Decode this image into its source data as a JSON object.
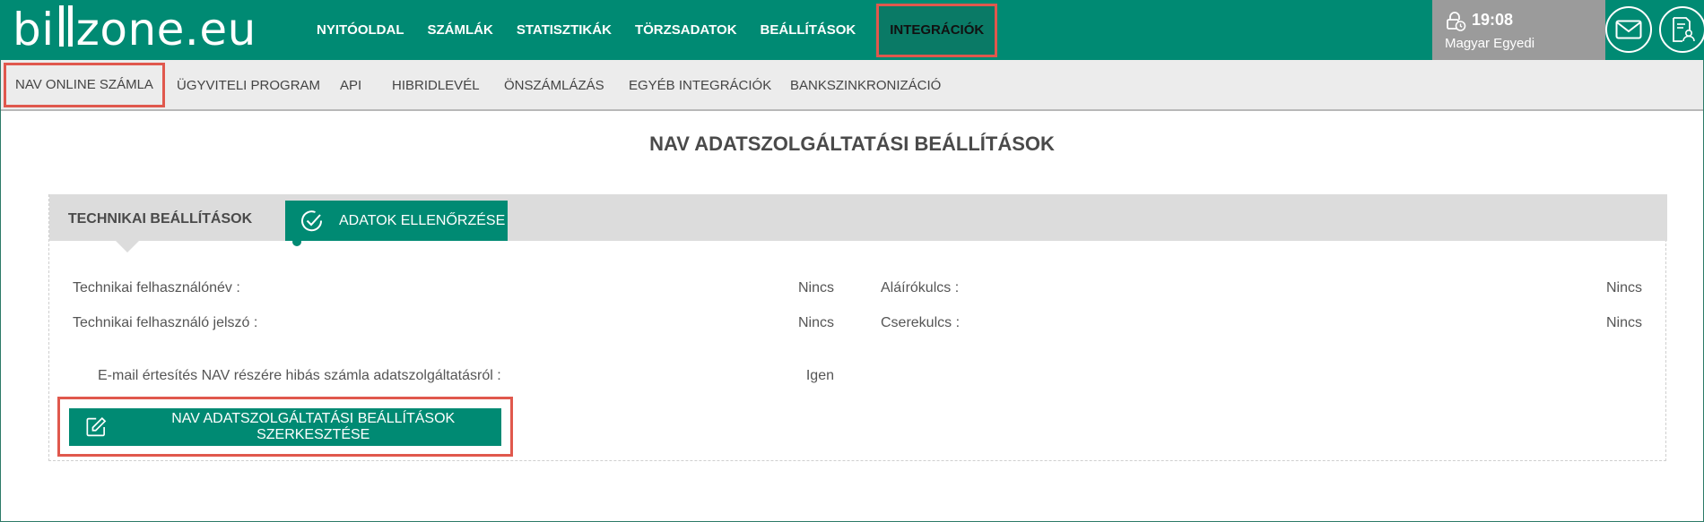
{
  "brand": {
    "logo_text_pre": "bi",
    "logo_text_post": "zone.eu"
  },
  "main_nav": [
    {
      "label": "NYITÓOLDAL"
    },
    {
      "label": "SZÁMLÁK"
    },
    {
      "label": "STATISZTIKÁK"
    },
    {
      "label": "TÖRZSADATOK"
    },
    {
      "label": "BEÁLLÍTÁSOK"
    },
    {
      "label": "INTEGRÁCIÓK",
      "active": true
    }
  ],
  "user": {
    "time": "19:08",
    "name": "Magyar Egyedi"
  },
  "sub_nav": [
    {
      "label": "NAV ONLINE SZÁMLA",
      "active": true
    },
    {
      "label": "ÜGYVITELI PROGRAM"
    },
    {
      "label": "API"
    },
    {
      "label": "HIBRIDLEVÉL"
    },
    {
      "label": "ÖNSZÁMLÁZÁS"
    },
    {
      "label": "EGYÉB INTEGRÁCIÓK"
    },
    {
      "label": "BANKSZINKRONIZÁCIÓ"
    }
  ],
  "page_title": "NAV ADATSZOLGÁLTATÁSI BEÁLLÍTÁSOK",
  "tabs": [
    {
      "label": "TECHNIKAI BEÁLLÍTÁSOK"
    },
    {
      "label": "ADATOK ELLENŐRZÉSE"
    }
  ],
  "fields": {
    "tech_user": {
      "label": "Technikai felhasználónév :",
      "value": "Nincs"
    },
    "tech_pass": {
      "label": "Technikai felhasználó jelszó :",
      "value": "Nincs"
    },
    "sign_key": {
      "label": "Aláírókulcs :",
      "value": "Nincs"
    },
    "exchange_key": {
      "label": "Cserekulcs :",
      "value": "Nincs"
    },
    "email_notify": {
      "label": "E-mail értesítés NAV részére hibás számla adatszolgáltatásról :",
      "value": "Igen"
    }
  },
  "edit_button": {
    "label": "NAV ADATSZOLGÁLTATÁSI BEÁLLÍTÁSOK SZERKESZTÉSE"
  },
  "colors": {
    "primary": "#008a73",
    "highlight": "#e0584d",
    "subnav_bg": "#ececec",
    "user_bg": "#9b9b9b"
  },
  "icons": [
    "lock-clock-icon",
    "mail-icon",
    "user-invoice-icon",
    "check-circle-icon",
    "edit-icon"
  ]
}
